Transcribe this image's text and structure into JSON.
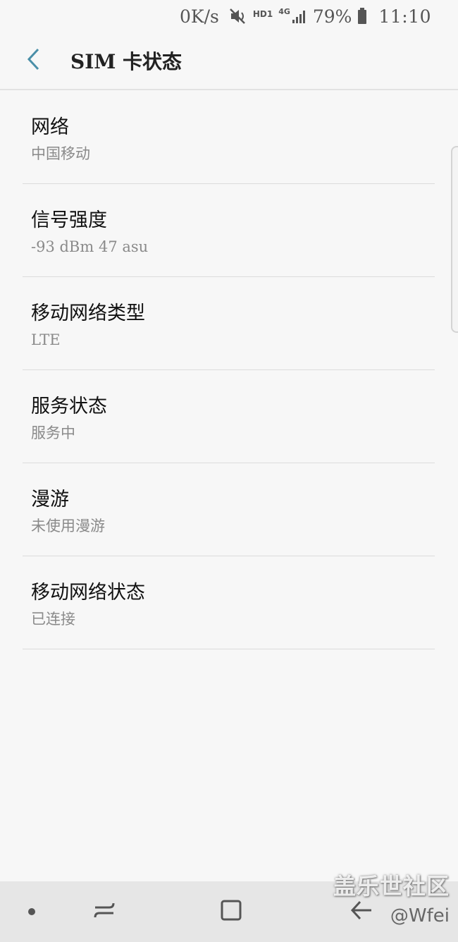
{
  "status_bar": {
    "net_speed": "0K/s",
    "hd_label": "HD1",
    "network_label": "4G",
    "battery": "79%",
    "time": "11:10",
    "icons": [
      "mute-icon",
      "signal-icon",
      "battery-icon"
    ]
  },
  "header": {
    "title": "SIM 卡状态",
    "back_icon": "chevron-left-icon",
    "accent_color": "#4a8fa8"
  },
  "items": [
    {
      "title": "网络",
      "value": "中国移动"
    },
    {
      "title": "信号强度",
      "value": "-93 dBm 47 asu"
    },
    {
      "title": "移动网络类型",
      "value": "LTE"
    },
    {
      "title": "服务状态",
      "value": "服务中"
    },
    {
      "title": "漫游",
      "value": "未使用漫游"
    },
    {
      "title": "移动网络状态",
      "value": "已连接"
    }
  ],
  "nav_bar": {
    "buttons": [
      "dot-icon",
      "recents-icon",
      "home-icon",
      "back-arrow-icon"
    ]
  },
  "watermark": {
    "line1": "盖乐世社区",
    "line2": "@Wfei"
  }
}
